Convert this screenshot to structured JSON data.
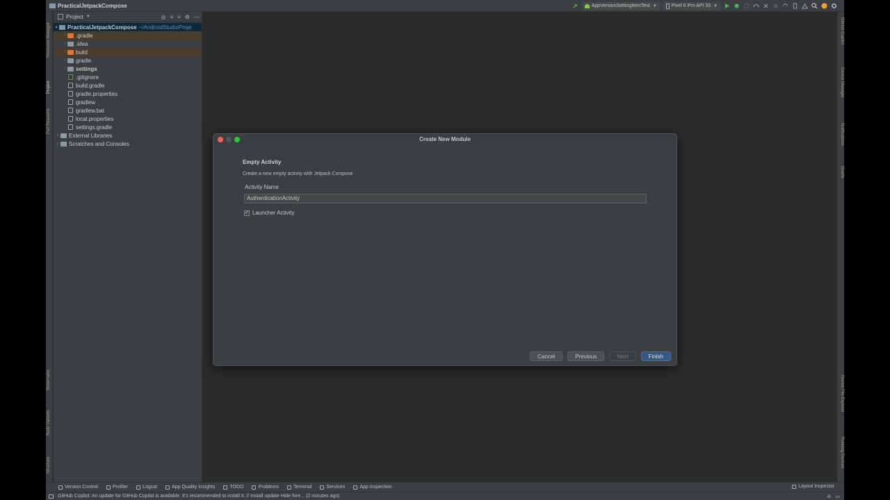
{
  "window": {
    "project_title": "PracticalJetpackCompose"
  },
  "toolbar": {
    "run_config": "AppVersionSettingItemTest",
    "device": "Pixel 6 Pro API 33"
  },
  "left_stripe": {
    "items": [
      "Resource Manager",
      "Project",
      "Pull Requests",
      "Bookmarks",
      "Build Variants",
      "Structure"
    ]
  },
  "right_stripe": {
    "items": [
      "GitHub Copilot",
      "Device Manager",
      "Notifications",
      "Gradle",
      "Device File Explorer",
      "Running Devices"
    ]
  },
  "project_panel": {
    "title": "Project",
    "root": {
      "name": "PracticalJetpackCompose",
      "path": "~/AndroidStudioProje"
    },
    "items": [
      {
        "label": ".gradle"
      },
      {
        "label": ".idea"
      },
      {
        "label": "build"
      },
      {
        "label": "gradle"
      },
      {
        "label": "settings"
      },
      {
        "label": ".gitignore"
      },
      {
        "label": "build.gradle"
      },
      {
        "label": "gradle.properties"
      },
      {
        "label": "gradlew"
      },
      {
        "label": "gradlew.bat"
      },
      {
        "label": "local.properties"
      },
      {
        "label": "settings.gradle"
      },
      {
        "label": "External Libraries"
      },
      {
        "label": "Scratches and Consoles"
      }
    ]
  },
  "dialog": {
    "title": "Create New Module",
    "heading": "Empty Activity",
    "description": "Create a new empty activity with Jetpack Compose",
    "activity_name_label": "Activity Name",
    "activity_name_value": "AuthenticationActivity",
    "launcher_label": "Launcher Activity",
    "launcher_checked": true,
    "buttons": {
      "cancel": "Cancel",
      "previous": "Previous",
      "next": "Next",
      "finish": "Finish"
    }
  },
  "bottom_tools": {
    "items": [
      "Version Control",
      "Profiler",
      "Logcat",
      "App Quality Insights",
      "TODO",
      "Problems",
      "Terminal",
      "Services",
      "App Inspection"
    ],
    "layout_inspector": "Layout Inspector"
  },
  "status_bar": {
    "message": "GitHub Copilot: An update for GitHub Copilot is available. It's recommended to install it. // Install update   Hide fore... (2 minutes ago)"
  }
}
